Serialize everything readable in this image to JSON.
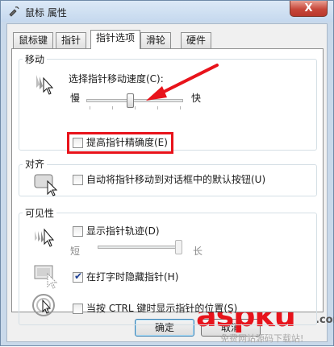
{
  "window": {
    "title": "鼠标 属性",
    "close_label": "X"
  },
  "tabs": [
    {
      "label": "鼠标键"
    },
    {
      "label": "指针"
    },
    {
      "label": "指针选项"
    },
    {
      "label": "滑轮"
    },
    {
      "label": "硬件"
    }
  ],
  "active_tab": "指针选项",
  "motion": {
    "label": "移动",
    "speed_label": "选择指针移动速度(C):",
    "slow": "慢",
    "fast": "快",
    "speed_level": 0.45,
    "precision_label": "提高指针精确度(E)",
    "precision_checked": false
  },
  "snap": {
    "label": "对齐",
    "snap_label": "自动将指针移动到对话框中的默认按钮(U)",
    "snap_checked": false
  },
  "visibility": {
    "label": "可见性",
    "trails_label": "显示指针轨迹(D)",
    "trails_checked": false,
    "short": "短",
    "long": "长",
    "trail_level": 1.0,
    "hide_label": "在打字时隐藏指针(H)",
    "hide_checked": true,
    "ctrl_label": "当按 CTRL 键时显示指针的位置(S)",
    "ctrl_checked": false
  },
  "buttons": {
    "ok": "确定",
    "cancel": "取消"
  },
  "watermark": {
    "main": "aspku",
    "sub": "免费网站源码下载站!",
    "com": ".com"
  },
  "colors": {
    "highlight": "#e8131b",
    "title_bar": "#c5d8ee"
  }
}
